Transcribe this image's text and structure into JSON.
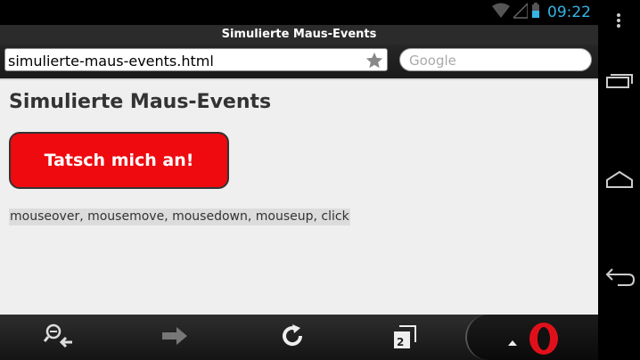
{
  "status": {
    "time": "09:22"
  },
  "browser": {
    "page_title": "Simulierte Maus-Events",
    "url": "simulierte-maus-events.html",
    "search_placeholder": "Google",
    "tab_count": "2"
  },
  "page": {
    "heading": "Simulierte Maus-Events",
    "button_label": "Tatsch mich an!",
    "event_log": "mouseover, mousemove, mousedown, mouseup, click",
    "button_color": "#ee0a0f"
  },
  "colors": {
    "clock": "#33b5e5",
    "opera_red": "#e0101a"
  }
}
